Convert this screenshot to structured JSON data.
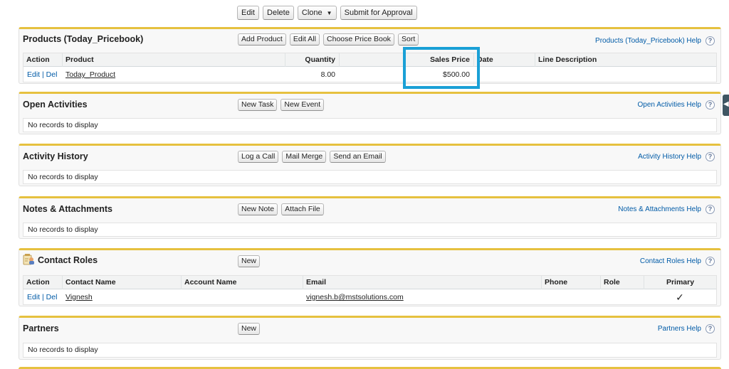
{
  "top_buttons": {
    "edit": "Edit",
    "delete": "Delete",
    "clone": "Clone",
    "clone_caret": "▼",
    "submit": "Submit for Approval"
  },
  "products": {
    "title": "Products (Today_Pricebook)",
    "buttons": {
      "add_product": "Add Product",
      "edit_all": "Edit All",
      "choose_price_book": "Choose Price Book",
      "sort": "Sort"
    },
    "help": "Products (Today_Pricebook) Help",
    "columns": {
      "action": "Action",
      "product": "Product",
      "quantity": "Quantity",
      "sales_price": "Sales Price",
      "date": "Date",
      "line_description": "Line Description"
    },
    "row": {
      "edit": "Edit",
      "sep": "|",
      "del": "Del",
      "product": "Today_Product",
      "quantity": "8.00",
      "sales_price": "$500.00"
    }
  },
  "open_activities": {
    "title": "Open Activities",
    "buttons": {
      "new_task": "New Task",
      "new_event": "New Event"
    },
    "help": "Open Activities Help",
    "empty": "No records to display"
  },
  "activity_history": {
    "title": "Activity History",
    "buttons": {
      "log_call": "Log a Call",
      "mail_merge": "Mail Merge",
      "send_email": "Send an Email"
    },
    "help": "Activity History Help",
    "empty": "No records to display"
  },
  "notes": {
    "title": "Notes & Attachments",
    "buttons": {
      "new_note": "New Note",
      "attach_file": "Attach File"
    },
    "help": "Notes & Attachments Help",
    "empty": "No records to display"
  },
  "contact_roles": {
    "title": "Contact Roles",
    "buttons": {
      "new": "New"
    },
    "help": "Contact Roles Help",
    "columns": {
      "action": "Action",
      "contact_name": "Contact Name",
      "account_name": "Account Name",
      "email": "Email",
      "phone": "Phone",
      "role": "Role",
      "primary": "Primary"
    },
    "row": {
      "edit": "Edit",
      "sep": "|",
      "del": "Del",
      "contact_name": "Vignesh",
      "email": "vignesh.b@mstsolutions.com",
      "primary": "✓"
    }
  },
  "partners": {
    "title": "Partners",
    "buttons": {
      "new": "New"
    },
    "help": "Partners Help",
    "empty": "No records to display"
  },
  "help_icon": "?",
  "sidebar_toggle": "◀",
  "colors": {
    "section_border": "#e6c13f",
    "highlight": "#1aa0d6",
    "link": "#015ba7"
  }
}
